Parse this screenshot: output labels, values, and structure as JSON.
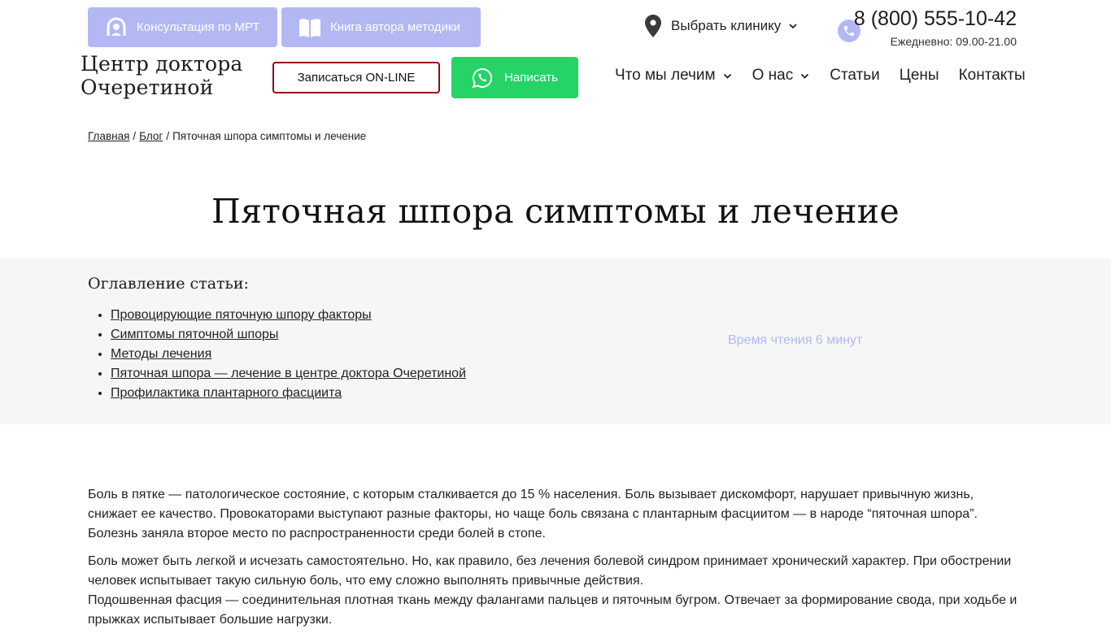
{
  "topbar": {
    "mri_label": "Консультация по МРТ",
    "book_label": "Книга автора методики",
    "clinic_label": "Выбрать клинику",
    "phone": "8 (800) 555-10-42",
    "hours": "Ежедневно: 09.00-21.00"
  },
  "header": {
    "logo_line1": "Центр доктора",
    "logo_line2": "Очеретиной",
    "online_label": "Записаться ON-LINE",
    "write_label": "Написать",
    "menu": [
      {
        "label": "Что мы лечим"
      },
      {
        "label": "О нас"
      },
      {
        "label": "Статьи"
      },
      {
        "label": "Цены"
      },
      {
        "label": "Контакты"
      }
    ]
  },
  "breadcrumb": {
    "home": "Главная",
    "separator": "/",
    "blog": "Блог",
    "current": "Пяточная шпора симптомы и лечение"
  },
  "page_title": "Пяточная шпора симптомы и лечение",
  "toc": {
    "title": "Оглавление статьи:",
    "items": [
      "Провоцирующие пяточную шпору факторы",
      "Симптомы пяточной шпоры",
      "Методы лечения",
      "Пяточная шпора — лечение в центре доктора Очеретиной",
      "Профилактика плантарного фасциита"
    ],
    "read_time": "Время чтения 6 минут"
  },
  "article": {
    "paragraphs": [
      "Боль в пятке — патологическое состояние, с которым сталкивается до 15 % населения. Боль вызывает дискомфорт, нарушает привычную жизнь, снижает ее качество. Провокаторами выступают разные факторы, но чаще боль связана с плантарным фасциитом — в народе “пяточная шпора”. Болезнь заняла второе место по распространенности среди болей в стопе.",
      "Боль может быть легкой и исчезать самостоятельно. Но, как правило, без лечения болевой синдром принимает хронический характер. При обострении человек испытывает такую сильную боль, что ему сложно выполнять привычные действия.",
      "Подошвенная фасция — соединительная плотная ткань между фалангами пальцев и пяточным бугром. Отвечает за формирование свода, при ходьбе и прыжках испытывает большие нагрузки."
    ]
  },
  "colors": {
    "accent_lavender": "#b3b8f3",
    "whatsapp_green": "#25d366",
    "online_border": "#8a0d1a",
    "toc_background": "#f6f6f6"
  },
  "icons": {
    "mri": "mri-scanner-icon",
    "book": "open-book-icon",
    "clinic": "map-pin-icon",
    "phone": "phone-icon",
    "whatsapp": "whatsapp-icon",
    "dropdown": "chevron-down-icon"
  }
}
